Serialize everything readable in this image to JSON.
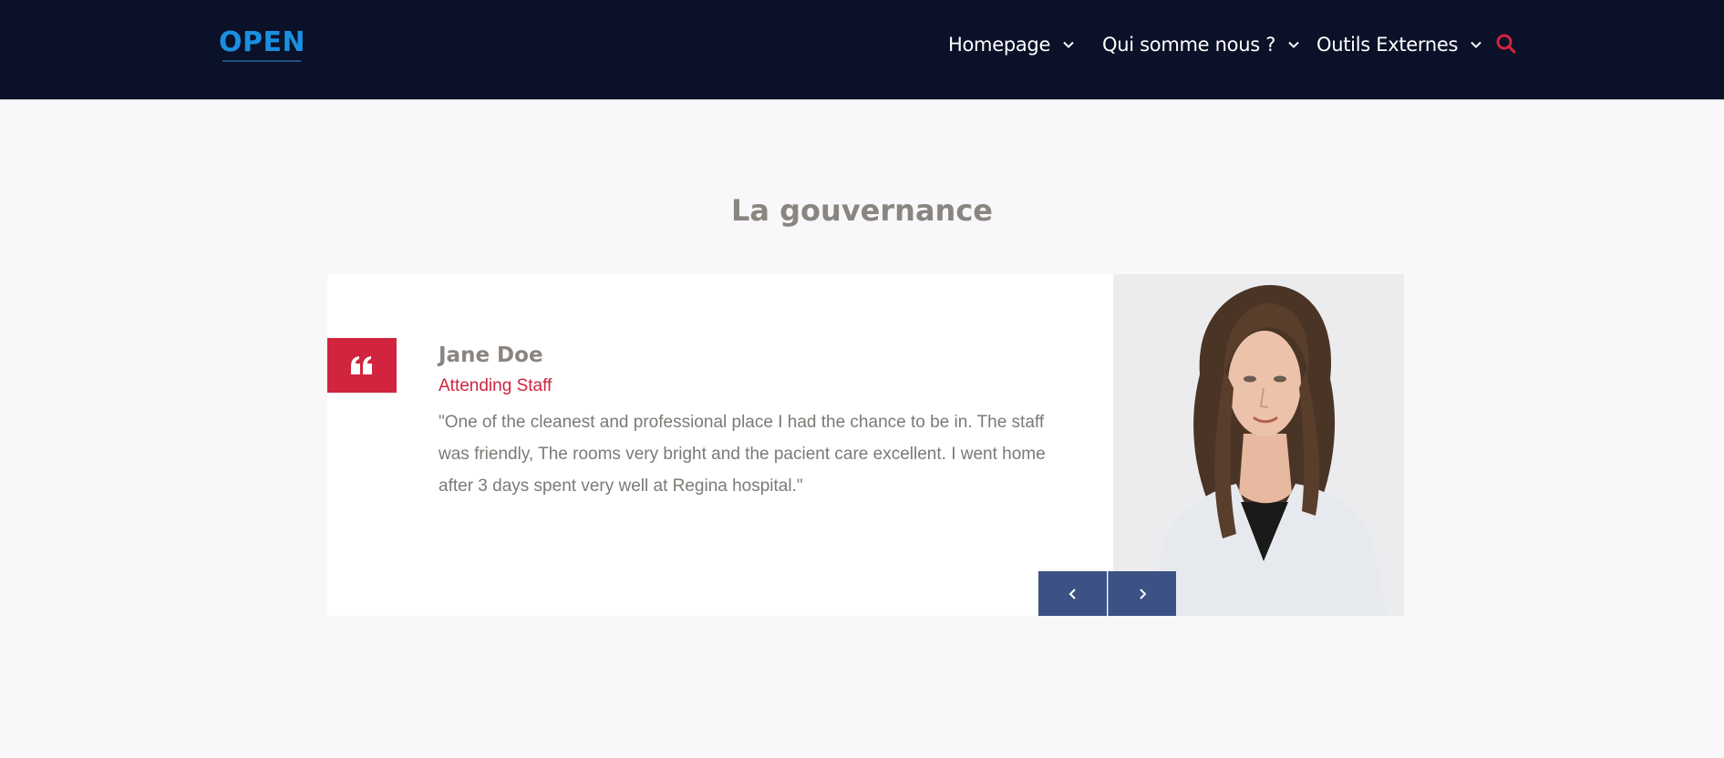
{
  "header": {
    "logo_text": "OPEN",
    "nav": [
      {
        "label": "Homepage"
      },
      {
        "label": "Qui somme nous ?"
      },
      {
        "label": "Outils Externes"
      }
    ],
    "icons": {
      "search": "search-icon",
      "dropdown": "chevron-down-icon"
    },
    "colors": {
      "background": "#0a1128",
      "logo": "#1a8fe0",
      "search": "#d0243f"
    }
  },
  "section": {
    "title": "La gouvernance"
  },
  "testimonial": {
    "name": "Jane Doe",
    "role": "Attending Staff",
    "quote": "\"One of the cleanest and professional place I had the chance to be in. The staff was friendly, The rooms very bright and the pacient care excellent. I went home after 3 days spent very well at Regina hospital.\"",
    "icons": {
      "quote": "quote-icon",
      "prev": "chevron-left-icon",
      "next": "chevron-right-icon"
    },
    "colors": {
      "accent": "#d0243f",
      "nav_button": "#3c5285"
    }
  }
}
